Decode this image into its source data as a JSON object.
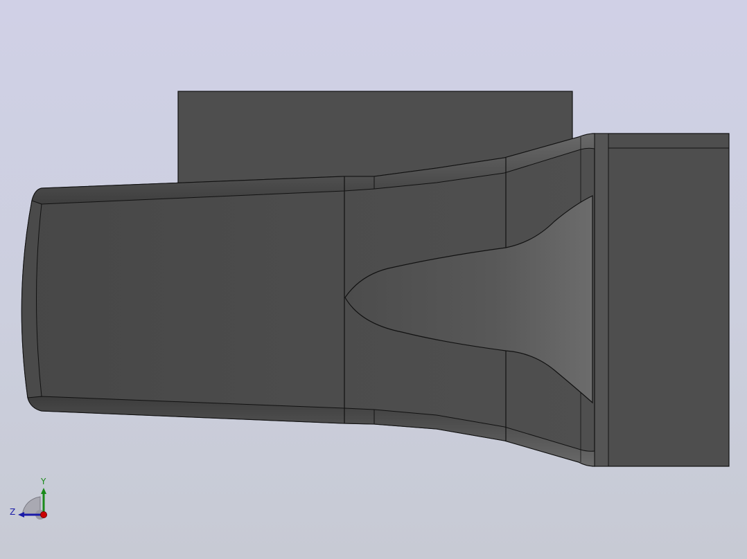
{
  "viewport": {
    "background_top": "#d0d0e6",
    "background_bottom": "#c7cad4"
  },
  "model": {
    "body_color": "#4d4d4d",
    "edge_color": "#111111",
    "cavity_highlight": "#6a6a6a"
  },
  "triad": {
    "x_color": "#cc0000",
    "y_color": "#1a8a1a",
    "z_color": "#1a1aa8",
    "y_label": "Y",
    "z_label": "Z",
    "icons": [
      "view-orientation-triad-icon"
    ]
  }
}
